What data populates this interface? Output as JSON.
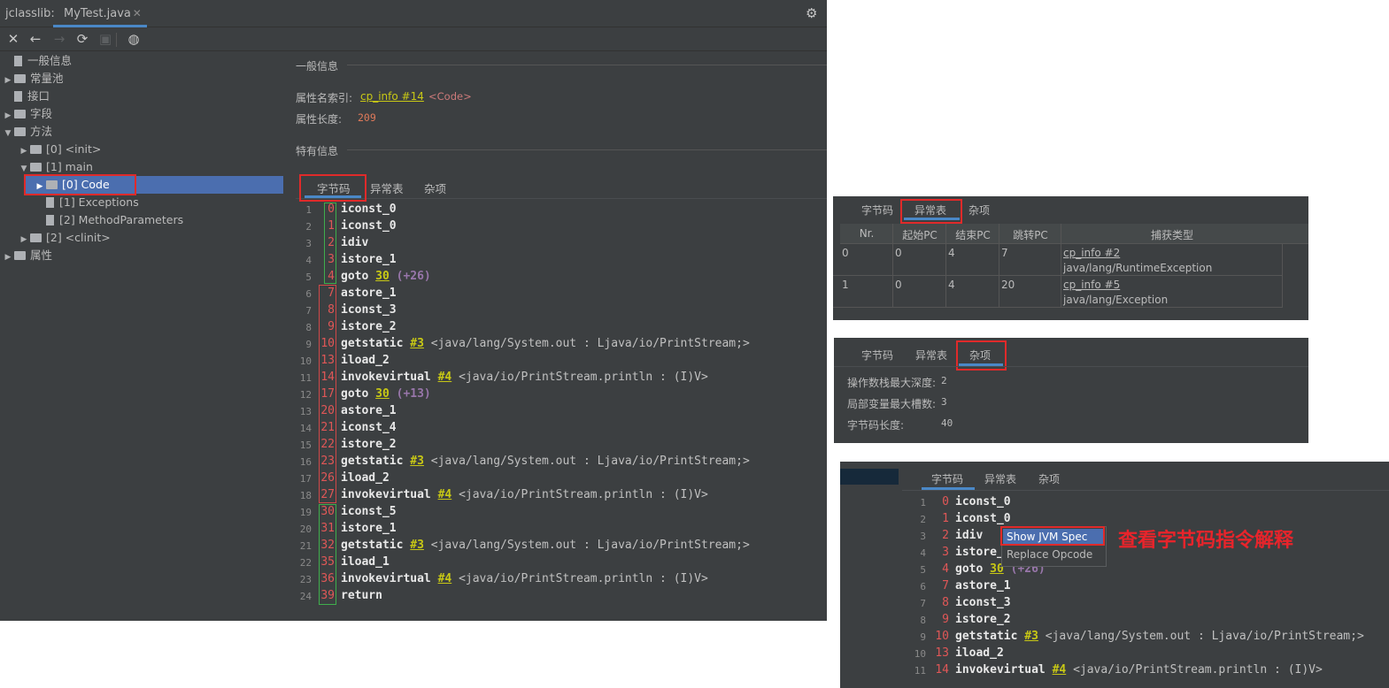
{
  "app_label": "jclasslib:",
  "file_tab": "MyTest.java",
  "tree": [
    {
      "label": "一般信息",
      "depth": 0,
      "arrow": "",
      "icon": "file"
    },
    {
      "label": "常量池",
      "depth": 0,
      "arrow": "▶",
      "icon": "folder"
    },
    {
      "label": "接口",
      "depth": 0,
      "arrow": "",
      "icon": "file"
    },
    {
      "label": "字段",
      "depth": 0,
      "arrow": "▶",
      "icon": "folder"
    },
    {
      "label": "方法",
      "depth": 0,
      "arrow": "▼",
      "icon": "folder"
    },
    {
      "label": "[0] <init>",
      "depth": 1,
      "arrow": "▶",
      "icon": "folder"
    },
    {
      "label": "[1] main",
      "depth": 1,
      "arrow": "▼",
      "icon": "folder"
    },
    {
      "label": "[0] Code",
      "depth": 2,
      "arrow": "▶",
      "icon": "folder"
    },
    {
      "label": "[1] Exceptions",
      "depth": 2,
      "arrow": "",
      "icon": "file"
    },
    {
      "label": "[2] MethodParameters",
      "depth": 2,
      "arrow": "",
      "icon": "file"
    },
    {
      "label": "[2] <clinit>",
      "depth": 1,
      "arrow": "▶",
      "icon": "folder"
    },
    {
      "label": "属性",
      "depth": 0,
      "arrow": "▶",
      "icon": "folder"
    }
  ],
  "general": {
    "section": "一般信息",
    "name_index_label": "属性名索引:",
    "name_index_link": "cp_info #14",
    "name_index_value": "<Code>",
    "length_label": "属性长度:",
    "length_value": "209"
  },
  "specific_section": "特有信息",
  "subtabs": [
    "字节码",
    "异常表",
    "杂项"
  ],
  "bytecode": [
    {
      "pc": "0",
      "op": "iconst_0",
      "ref": "",
      "rest": "",
      "off": ""
    },
    {
      "pc": "1",
      "op": "iconst_0",
      "ref": "",
      "rest": "",
      "off": ""
    },
    {
      "pc": "2",
      "op": "idiv",
      "ref": "",
      "rest": "",
      "off": ""
    },
    {
      "pc": "3",
      "op": "istore_1",
      "ref": "",
      "rest": "",
      "off": ""
    },
    {
      "pc": "4",
      "op": "goto",
      "ref": "30",
      "rest": "",
      "off": "(+26)"
    },
    {
      "pc": "7",
      "op": "astore_1",
      "ref": "",
      "rest": "",
      "off": ""
    },
    {
      "pc": "8",
      "op": "iconst_3",
      "ref": "",
      "rest": "",
      "off": ""
    },
    {
      "pc": "9",
      "op": "istore_2",
      "ref": "",
      "rest": "",
      "off": ""
    },
    {
      "pc": "10",
      "op": "getstatic",
      "ref": "#3",
      "rest": "<java/lang/System.out : Ljava/io/PrintStream;>",
      "off": ""
    },
    {
      "pc": "13",
      "op": "iload_2",
      "ref": "",
      "rest": "",
      "off": ""
    },
    {
      "pc": "14",
      "op": "invokevirtual",
      "ref": "#4",
      "rest": "<java/io/PrintStream.println : (I)V>",
      "off": ""
    },
    {
      "pc": "17",
      "op": "goto",
      "ref": "30",
      "rest": "",
      "off": "(+13)"
    },
    {
      "pc": "20",
      "op": "astore_1",
      "ref": "",
      "rest": "",
      "off": ""
    },
    {
      "pc": "21",
      "op": "iconst_4",
      "ref": "",
      "rest": "",
      "off": ""
    },
    {
      "pc": "22",
      "op": "istore_2",
      "ref": "",
      "rest": "",
      "off": ""
    },
    {
      "pc": "23",
      "op": "getstatic",
      "ref": "#3",
      "rest": "<java/lang/System.out : Ljava/io/PrintStream;>",
      "off": ""
    },
    {
      "pc": "26",
      "op": "iload_2",
      "ref": "",
      "rest": "",
      "off": ""
    },
    {
      "pc": "27",
      "op": "invokevirtual",
      "ref": "#4",
      "rest": "<java/io/PrintStream.println : (I)V>",
      "off": ""
    },
    {
      "pc": "30",
      "op": "iconst_5",
      "ref": "",
      "rest": "",
      "off": ""
    },
    {
      "pc": "31",
      "op": "istore_1",
      "ref": "",
      "rest": "",
      "off": ""
    },
    {
      "pc": "32",
      "op": "getstatic",
      "ref": "#3",
      "rest": "<java/lang/System.out : Ljava/io/PrintStream;>",
      "off": ""
    },
    {
      "pc": "35",
      "op": "iload_1",
      "ref": "",
      "rest": "",
      "off": ""
    },
    {
      "pc": "36",
      "op": "invokevirtual",
      "ref": "#4",
      "rest": "<java/io/PrintStream.println : (I)V>",
      "off": ""
    },
    {
      "pc": "39",
      "op": "return",
      "ref": "",
      "rest": "",
      "off": ""
    }
  ],
  "exception_panel": {
    "headers": [
      "Nr.",
      "起始PC",
      "结束PC",
      "跳转PC",
      "捕获类型"
    ],
    "rows": [
      {
        "nr": "0",
        "start": "0",
        "end": "4",
        "handler": "7",
        "link": "cp_info #2",
        "type": "java/lang/RuntimeException"
      },
      {
        "nr": "1",
        "start": "0",
        "end": "4",
        "handler": "20",
        "link": "cp_info #5",
        "type": "java/lang/Exception"
      }
    ]
  },
  "misc_panel": {
    "max_stack_label": "操作数栈最大深度:",
    "max_stack_value": "2",
    "max_locals_label": "局部变量最大槽数:",
    "max_locals_value": "3",
    "code_length_label": "字节码长度:",
    "code_length_value": "40"
  },
  "context_menu": {
    "items": [
      "Show JVM Spec",
      "Replace Opcode"
    ]
  },
  "annotation": "查看字节码指令解释",
  "bottom_code_lines": 11,
  "colors": {
    "accent": "#4a88c7",
    "selection": "#4b6eaf",
    "highlight_box": "#e02a2a",
    "annotation": "#e8242b"
  }
}
